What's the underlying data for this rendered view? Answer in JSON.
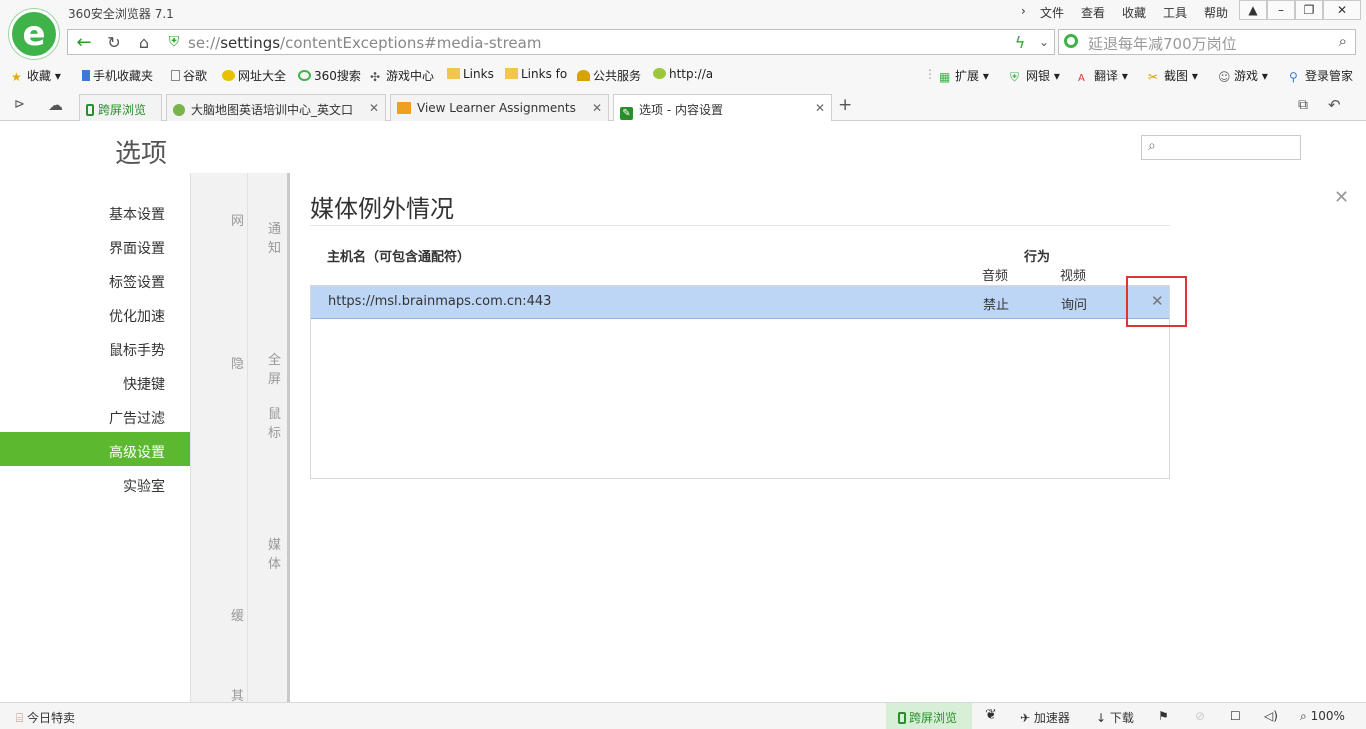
{
  "app": {
    "title": "360安全浏览器 7.1"
  },
  "menu": [
    "文件",
    "查看",
    "收藏",
    "工具",
    "帮助"
  ],
  "address": {
    "url_scheme": "se://",
    "url_host": "settings",
    "url_path": "/contentExceptions#media-stream"
  },
  "search": {
    "placeholder": "延退每年减700万岗位"
  },
  "bookmarks": {
    "items": [
      "收藏",
      "手机收藏夹",
      "谷歌",
      "网址大全",
      "360搜索",
      "游戏中心",
      "Links",
      "Links fo",
      "公共服务",
      "http://a"
    ],
    "right": [
      "扩展",
      "网银",
      "翻译",
      "截图",
      "游戏",
      "登录管家"
    ]
  },
  "tabs": [
    {
      "label": "跨屏浏览",
      "color": "#2a8f2a"
    },
    {
      "label": "大脑地图英语培训中心_英文口"
    },
    {
      "label": "View Learner Assignments"
    },
    {
      "label": "选项 - 内容设置"
    }
  ],
  "options": {
    "title": "选项",
    "sidebar": [
      "基本设置",
      "界面设置",
      "标签设置",
      "优化加速",
      "鼠标手势",
      "快捷键",
      "广告过滤",
      "高级设置",
      "实验室"
    ],
    "active_index": 7,
    "accent": "#5cb82f",
    "behind_text": [
      "网",
      "通知",
      "隐",
      "全屏",
      "鼠标",
      "媒体",
      "缓",
      "其"
    ]
  },
  "dialog": {
    "title": "媒体例外情况",
    "col_host": "主机名（可包含通配符）",
    "col_behavior": "行为",
    "col_audio": "音频",
    "col_video": "视频",
    "rows": [
      {
        "host": "https://msl.brainmaps.com.cn:443",
        "audio": "禁止",
        "video": "询问"
      }
    ]
  },
  "statusbar": {
    "promo": "今日特卖",
    "cross": "跨屏浏览",
    "accel": "加速器",
    "download": "下载",
    "zoom": "100%"
  }
}
